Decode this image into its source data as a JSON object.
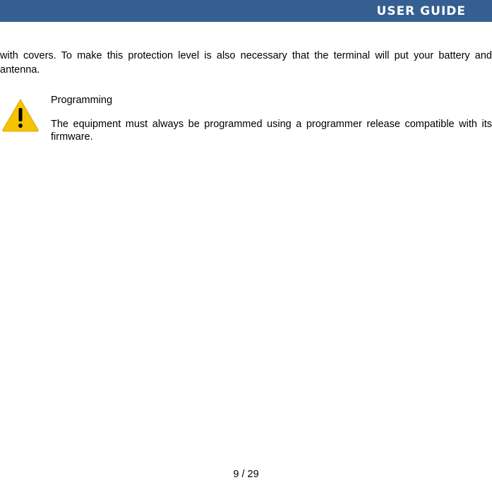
{
  "header": {
    "title": "USER GUIDE",
    "bar_color": "#355f91"
  },
  "body": {
    "paragraph_1": "with covers. To make this protection level is also necessary that the terminal will put your battery and antenna.",
    "warning": {
      "icon": "warning-triangle-icon",
      "icon_color": "#f5c400",
      "title": "Programming",
      "text": "The equipment must always be programmed using a programmer release compatible with its firmware."
    }
  },
  "footer": {
    "page_number": "9 / 29"
  }
}
